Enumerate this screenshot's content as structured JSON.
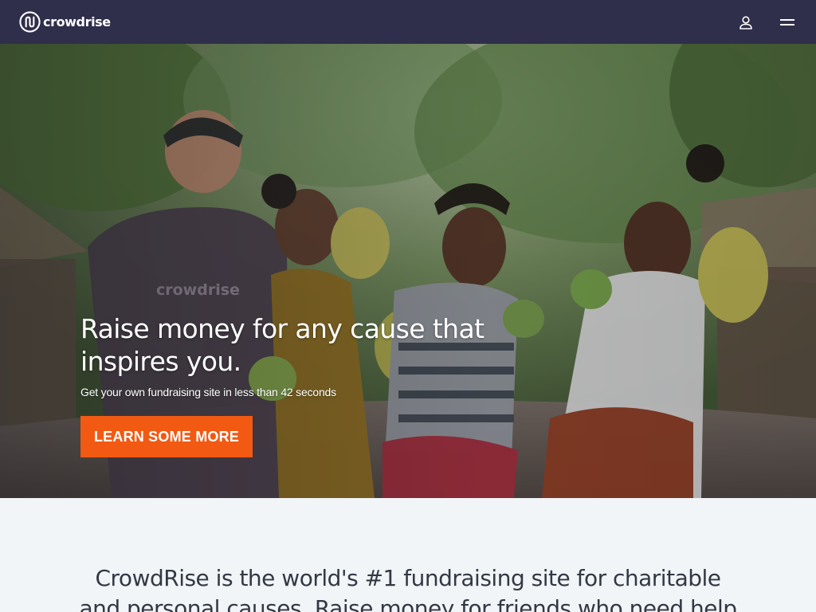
{
  "nav": {
    "logo_text": "crowdrise",
    "icons": [
      "logo-icon",
      "user-icon",
      "menu-icon"
    ]
  },
  "hero": {
    "title": "Raise money for any cause that inspires you.",
    "subtitle": "Get your own fundraising site in less than 42 seconds",
    "cta_label": "LEARN SOME MORE",
    "shirt_text": "crowdrise"
  },
  "intro": {
    "text": "CrowdRise is the world's #1 fundraising site for charitable and personal causes. Raise money for friends who need help"
  },
  "colors": {
    "nav_bg": "#2f2e4b",
    "cta_bg": "#f25a13",
    "page_bg": "#f1f5f7",
    "text_dark": "#333845"
  }
}
